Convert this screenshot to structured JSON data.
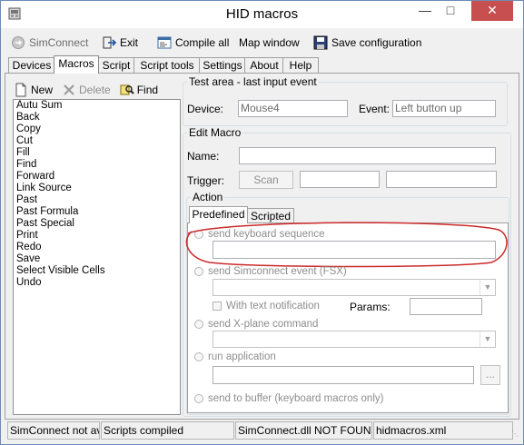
{
  "window": {
    "title": "HID macros"
  },
  "toolbar": {
    "simconnect": "SimConnect",
    "exit": "Exit",
    "compile_all": "Compile all",
    "map_window": "Map window",
    "save_configuration": "Save configuration"
  },
  "tabs": [
    "Devices",
    "Macros",
    "Script",
    "Script tools",
    "Settings",
    "About",
    "Help"
  ],
  "active_tab": "Macros",
  "macro_toolbar": {
    "new": "New",
    "delete": "Delete",
    "find": "Find"
  },
  "macros": [
    "Autu Sum",
    "Back",
    "Copy",
    "Cut",
    "Fill",
    "Find",
    "Forward",
    "Link Source",
    "Past",
    "Past Formula",
    "Past Special",
    "Print",
    "Redo",
    "Save",
    "Select Visible Cells",
    "Undo"
  ],
  "test_area": {
    "legend": "Test area - last input event",
    "device_label": "Device:",
    "device_value": "Mouse4",
    "event_label": "Event:",
    "event_value": "Left button up"
  },
  "edit_macro": {
    "legend": "Edit Macro",
    "name_label": "Name:",
    "name_value": "",
    "trigger_label": "Trigger:",
    "scan_button": "Scan",
    "trigger_value_1": "",
    "trigger_value_2": ""
  },
  "action": {
    "legend": "Action",
    "tabs": [
      "Predefined",
      "Scripted"
    ],
    "active_tab": "Predefined",
    "send_keyboard_sequence": "send keyboard sequence",
    "send_simconnect_event": "send Simconnect event (FSX)",
    "with_text_notification": "With text notification",
    "params_label": "Params:",
    "send_xplane_command": "send X-plane command",
    "run_application": "run application",
    "browse_button": "...",
    "send_to_buffer": "send to buffer (keyboard macros only)"
  },
  "status": {
    "simconnect": "SimConnect not av",
    "scripts": "Scripts compiled",
    "dll": "SimConnect.dll NOT FOUN",
    "config": "hidmacros.xml"
  },
  "colors": {
    "annotation_red": "#cc2a2a",
    "close_red": "#c74f4f"
  }
}
